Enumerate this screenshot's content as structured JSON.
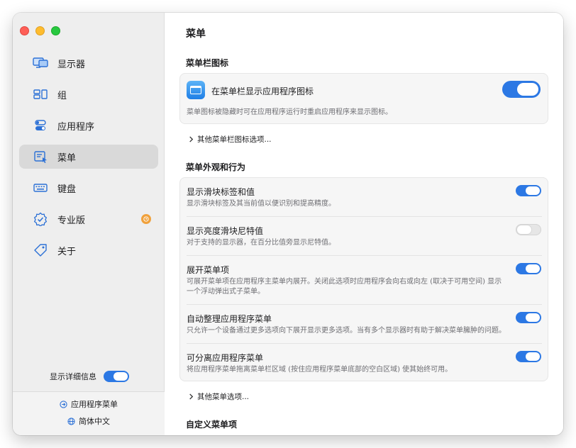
{
  "sidebar": {
    "items": [
      {
        "label": "显示器",
        "icon": "display-icon"
      },
      {
        "label": "组",
        "icon": "group-icon"
      },
      {
        "label": "应用程序",
        "icon": "toggles-icon"
      },
      {
        "label": "菜单",
        "icon": "menu-icon",
        "selected": true
      },
      {
        "label": "键盘",
        "icon": "keyboard-icon"
      },
      {
        "label": "专业版",
        "icon": "badge-check-icon"
      },
      {
        "label": "关于",
        "icon": "tag-icon"
      }
    ],
    "detail_label": "显示详细信息",
    "footer_app_menu": "应用程序菜单",
    "footer_language": "简体中文"
  },
  "main": {
    "title": "菜单",
    "section_icon": {
      "title": "菜单栏图标",
      "row_title": "在菜单栏显示应用程序图标",
      "row_desc": "菜单图标被隐藏时可在应用程序运行时重启应用程序来显示图标。",
      "more": "其他菜单栏图标选项..."
    },
    "section_behavior": {
      "title": "菜单外观和行为",
      "rows": [
        {
          "title": "显示滑块标签和值",
          "desc": "显示滑块标签及其当前值以便识别和提高精度。",
          "on": true
        },
        {
          "title": "显示亮度滑块尼特值",
          "desc": "对于支持的显示器，在百分比值旁显示尼特值。",
          "on": false
        },
        {
          "title": "展开菜单项",
          "desc": "可展开菜单项在应用程序主菜单内展开。关闭此选项时应用程序会向右或向左 (取决于可用空间) 显示",
          "desc2": "一个浮动弹出式子菜单。",
          "on": true
        },
        {
          "title": "自动整理应用程序菜单",
          "desc": "只允许一个设备通过更多选项向下展开显示更多选项。当有多个显示器时有助于解决菜单臃肿的问题。",
          "on": true
        },
        {
          "title": "可分离应用程序菜单",
          "desc": "将应用程序菜单拖离菜单栏区域 (按住应用程序菜单底部的空白区域) 使其始终可用。",
          "on": true
        }
      ],
      "more": "其他菜单选项..."
    },
    "section_custom": {
      "title": "自定义菜单项"
    }
  },
  "colors": {
    "accent": "#2c78e4",
    "sidebar_bg": "#eeeeee",
    "badge": "#f0a13c"
  }
}
